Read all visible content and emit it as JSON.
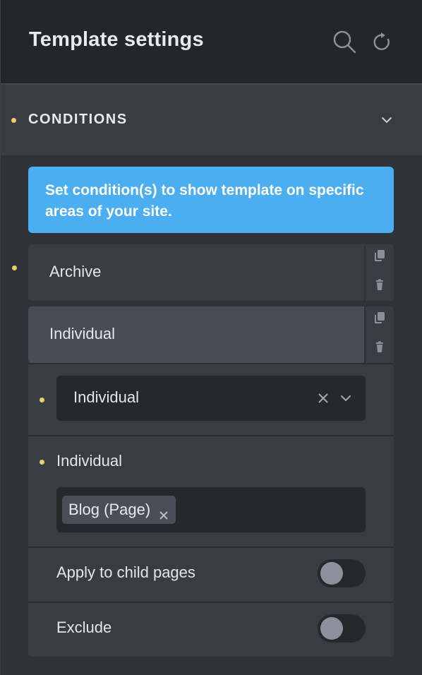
{
  "header": {
    "title": "Template settings",
    "search_icon": "search-icon",
    "refresh_icon": "refresh-icon"
  },
  "conditions": {
    "title": "CONDITIONS",
    "info": "Set condition(s) to show template on specific areas of your site.",
    "items": [
      {
        "label": "Archive"
      },
      {
        "label": "Individual"
      }
    ],
    "detail": {
      "select_value": "Individual",
      "field_label": "Individual",
      "tags": [
        "Blog (Page)"
      ],
      "toggles": [
        {
          "label": "Apply to child pages",
          "enabled": false
        },
        {
          "label": "Exclude",
          "enabled": false
        }
      ]
    }
  },
  "colors": {
    "accent_blue": "#4aaef0",
    "indicator_dot": "#f2cb64",
    "background": "#23262b"
  }
}
